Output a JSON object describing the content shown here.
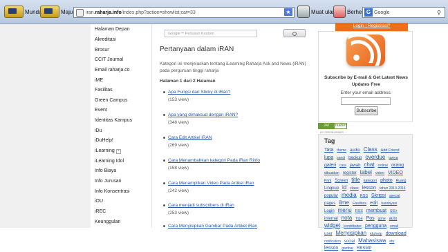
{
  "browser": {
    "back_label": "Mundur",
    "forward_label": "Maju",
    "url_prefix": "iran.",
    "url_host": "raharja.info",
    "url_path": "/index.php?action=showlist;cat=33",
    "reload_label": "Muat ulang",
    "stop_label": "Berhenti",
    "search_engine_icon": "G",
    "search_placeholder": "Google"
  },
  "left_nav": {
    "items": [
      "Halaman Depan",
      "Akreditasi",
      "Brosur",
      "CCIT Journal",
      "Email raharja.co",
      "iME",
      "Fasilitas",
      "Green Campus",
      "Event",
      "Identitas Kampus",
      "iDu",
      "iDuHelp!",
      "iLearning",
      "iLearning Idol",
      "Info Biaya",
      "Info Jurusan",
      "Info Konsentrasi",
      "iOU",
      "iREC",
      "Keunggulan"
    ],
    "expandable_icon": "plus-icon"
  },
  "search": {
    "placeholder": "Google™ Penusuri Kustom"
  },
  "main": {
    "title": "Pertanyaan dalam iRAN",
    "intro": "Kategori ini menjelaskan tentang iLearning Raharja Ask and News (iRAN) pada perguruan tinggi raharja",
    "pager": "Halaman 1 dari 2 Halaman",
    "posts": [
      {
        "title": "Apa Fungsi dari Sticky di iRan?",
        "views": "(153 view)"
      },
      {
        "title": "Apa yang dimaksud dengan iRAN?",
        "views": "(348 view)"
      },
      {
        "title": "Cara Edit Artikel iRAN",
        "views": "(269 view)"
      },
      {
        "title": "Cara Menambahkan kategori Pada iRan Rinfo",
        "views": "(158 view)"
      },
      {
        "title": "Cara Menampilkan Video Pada Artikel iRan",
        "views": "(242 view)"
      },
      {
        "title": "Cara menjadi subscribers di iRan",
        "views": "(253 view)"
      },
      {
        "title": "Cara Menyisipkan Gambar Pada Artikel iRan",
        "views": ""
      }
    ]
  },
  "sidebar": {
    "login_label": "Login",
    "login_separator": "|",
    "register_label": "Registrasi?",
    "subscribe_title": "Subscribe by E-mail & Get Latest News Updates Free",
    "email_label": "Enter your email address:",
    "subscribe_button": "Subscribe",
    "readers_count": "247",
    "readers_word": "readers",
    "readers_by": "BY FEEDBURNER",
    "tag_title": "Tag",
    "tags": [
      "Tata",
      "theme",
      "audio",
      "Class",
      "Add Friend",
      "lupa",
      "sandi",
      "backup",
      "overdue",
      "tanya",
      "galeri",
      "cara",
      "jawab",
      "chat",
      "online",
      "orang",
      "dibuatkan",
      "register",
      "tabel",
      "video",
      "VIDEO",
      "Print",
      "Screen",
      "title",
      "kategori",
      "photo",
      "Ruang",
      "Lingkup",
      "id",
      "class",
      "lesson",
      "tahun 2013-2014",
      "popular",
      "media",
      "RSS",
      "Skripsi",
      "special",
      "pages",
      "ilme",
      "Fasilitas",
      "edit",
      "handayani",
      "Login",
      "menu",
      "RSS",
      "membuat",
      "SIS+",
      "internal",
      "nota",
      "Tipe",
      "Pos",
      "gone",
      "auto",
      "widget",
      "kontributor",
      "pengguna",
      "email",
      "user",
      "Menyisipkan",
      "iduhelp",
      "download",
      "notification",
      "social",
      "Mahasiswa",
      "stu",
      "lesson",
      "gambar",
      "RBSMP"
    ]
  }
}
